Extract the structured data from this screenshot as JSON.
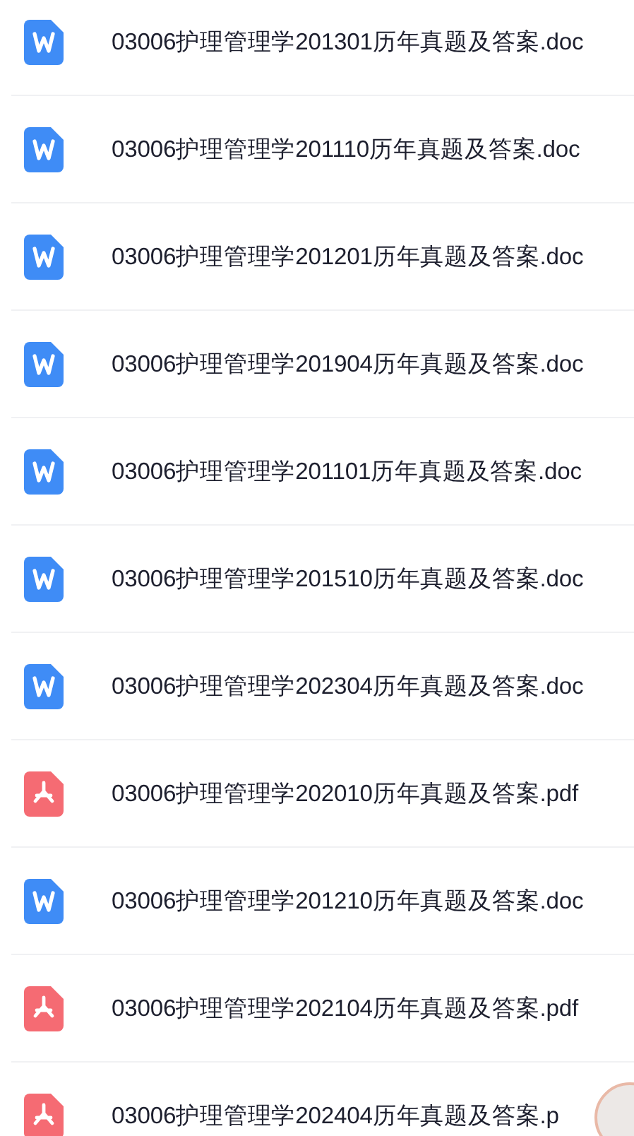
{
  "files": [
    {
      "name": "03006护理管理学201301历年真题及答案.doc",
      "kind": "word"
    },
    {
      "name": "03006护理管理学201110历年真题及答案.doc",
      "kind": "word"
    },
    {
      "name": "03006护理管理学201201历年真题及答案.doc",
      "kind": "word"
    },
    {
      "name": "03006护理管理学201904历年真题及答案.doc",
      "kind": "word"
    },
    {
      "name": "03006护理管理学201101历年真题及答案.doc",
      "kind": "word"
    },
    {
      "name": "03006护理管理学201510历年真题及答案.doc",
      "kind": "word"
    },
    {
      "name": "03006护理管理学202304历年真题及答案.doc",
      "kind": "word"
    },
    {
      "name": "03006护理管理学202010历年真题及答案.pdf",
      "kind": "pdf"
    },
    {
      "name": "03006护理管理学201210历年真题及答案.doc",
      "kind": "word"
    },
    {
      "name": "03006护理管理学202104历年真题及答案.pdf",
      "kind": "pdf"
    },
    {
      "name": "03006护理管理学202404历年真题及答案.p",
      "kind": "pdf"
    }
  ]
}
